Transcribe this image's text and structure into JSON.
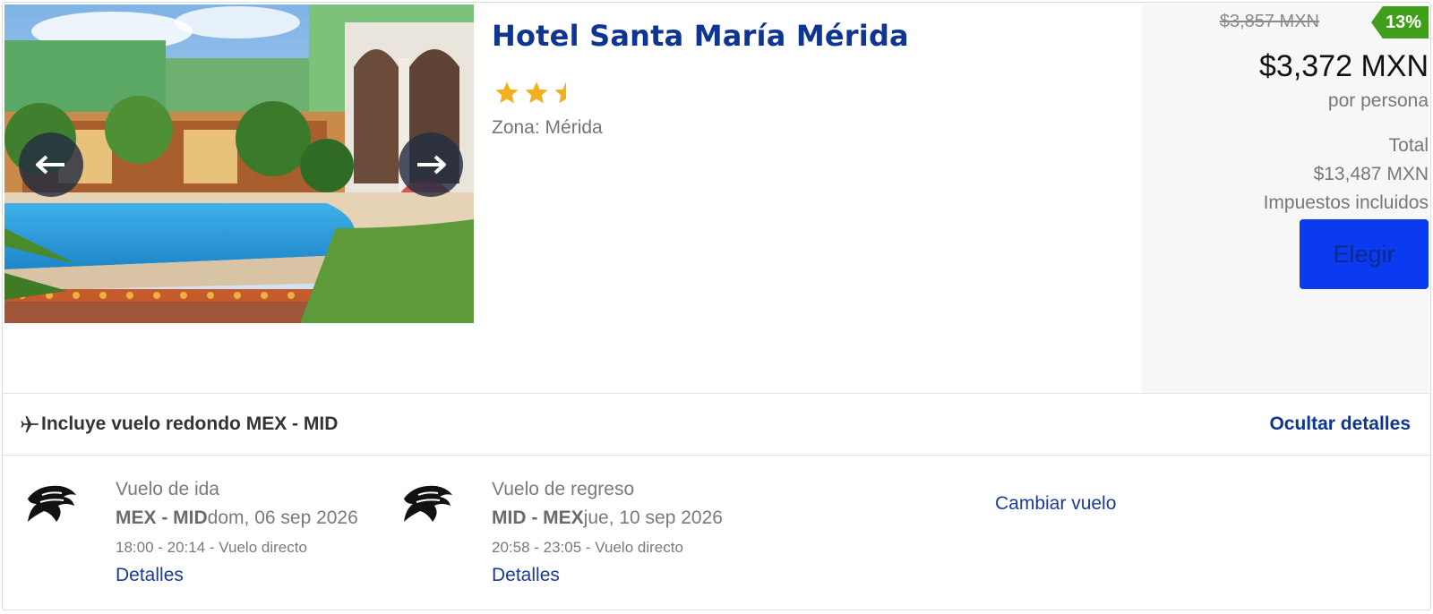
{
  "hotel": {
    "name": "Hotel Santa María Mérida",
    "rating": 2.5,
    "zone": "Zona: Mérida"
  },
  "pricing": {
    "old_price": "$3,857 MXN",
    "discount": "13%",
    "price": "$3,372 MXN",
    "per_person": "por persona",
    "total_label": "Total",
    "total_value": "$13,487 MXN",
    "taxes": "Impuestos incluidos",
    "choose_label": "Elegir"
  },
  "flight_summary": {
    "title": "Incluye vuelo redondo MEX - MID",
    "hide_details": "Ocultar detalles"
  },
  "flights": [
    {
      "label": "Vuelo de ida",
      "route": "MEX - MID",
      "date": "dom, 06 sep 2026",
      "times": "18:00 - 20:14 - Vuelo directo",
      "details": "Detalles"
    },
    {
      "label": "Vuelo de regreso",
      "route": "MID - MEX",
      "date": "jue, 10 sep 2026",
      "times": "20:58 - 23:05 - Vuelo directo",
      "details": "Detalles"
    }
  ],
  "change_flight": "Cambiar vuelo",
  "colors": {
    "brand_blue": "#0d3591",
    "button_blue": "#0a3bf0",
    "discount_green": "#3f9f1a",
    "star_gold": "#f2b01e"
  },
  "icons": {
    "prev": "arrow-left-icon",
    "next": "arrow-right-icon",
    "plane": "plane-icon",
    "airline": "airline-logo-icon",
    "star": "star-icon"
  }
}
